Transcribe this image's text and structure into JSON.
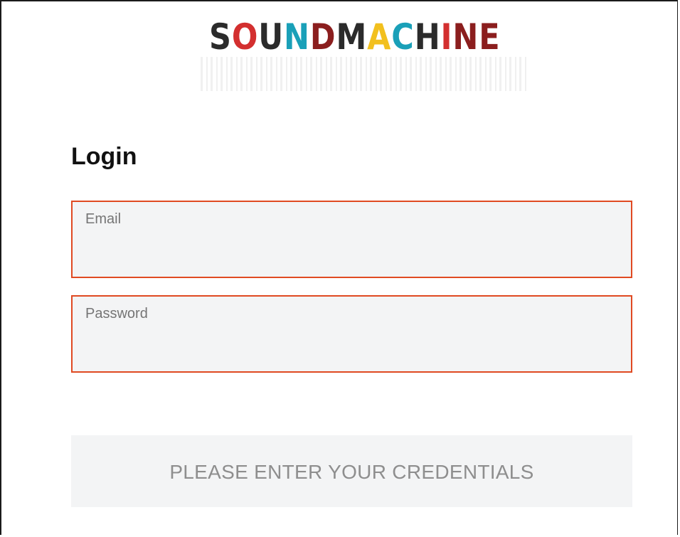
{
  "brand": {
    "letters": [
      {
        "ch": "S",
        "color": "#2b2b2b"
      },
      {
        "ch": "O",
        "color": "#d32f2f"
      },
      {
        "ch": "U",
        "color": "#2b2b2b"
      },
      {
        "ch": "N",
        "color": "#1aa0b8"
      },
      {
        "ch": "D",
        "color": "#8b1e1e"
      },
      {
        "ch": "M",
        "color": "#2b2b2b"
      },
      {
        "ch": "A",
        "color": "#f2c01e"
      },
      {
        "ch": "C",
        "color": "#1aa0b8"
      },
      {
        "ch": "H",
        "color": "#2b2b2b"
      },
      {
        "ch": "I",
        "color": "#d32f2f"
      },
      {
        "ch": "N",
        "color": "#8b1e1e"
      },
      {
        "ch": "E",
        "color": "#8b1e1e"
      }
    ],
    "name": "SOUNDMACHINE"
  },
  "login": {
    "title": "Login",
    "email": {
      "label": "Email",
      "value": ""
    },
    "password": {
      "label": "Password",
      "value": ""
    },
    "submit_label": "PLEASE ENTER YOUR CREDENTIALS"
  },
  "colors": {
    "field_border_error": "#e04a22",
    "field_background": "#f3f4f5",
    "button_background": "#f3f4f5",
    "button_text": "#8e8e8e"
  }
}
